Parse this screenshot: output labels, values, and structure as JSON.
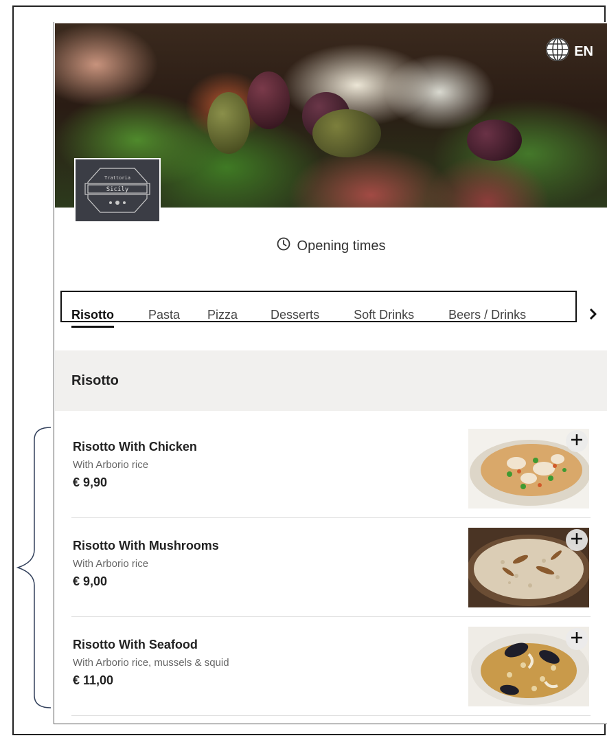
{
  "header": {
    "language": "EN",
    "logo_text_top": "Trattoria",
    "logo_text_main": "Sicily",
    "opening_times": "Opening times"
  },
  "tabs": [
    {
      "label": "Risotto",
      "active": true
    },
    {
      "label": "Pasta",
      "active": false
    },
    {
      "label": "Pizza",
      "active": false
    },
    {
      "label": "Desserts",
      "active": false
    },
    {
      "label": "Soft Drinks",
      "active": false
    },
    {
      "label": "Beers / Drinks",
      "active": false
    }
  ],
  "section": {
    "title": "Risotto",
    "items": [
      {
        "name": "Risotto With Chicken",
        "description": "With Arborio rice",
        "price": "€ 9,90",
        "image": "risotto-chicken"
      },
      {
        "name": "Risotto With Mushrooms",
        "description": "With Arborio rice",
        "price": "€ 9,00",
        "image": "risotto-mushrooms"
      },
      {
        "name": "Risotto With Seafood",
        "description": "With Arborio rice, mussels & squid",
        "price": "€ 11,00",
        "image": "risotto-seafood"
      }
    ]
  },
  "icons": {
    "globe": "globe-icon",
    "clock": "clock-icon",
    "chevron": "chevron-right-icon",
    "plus": "plus-icon"
  }
}
